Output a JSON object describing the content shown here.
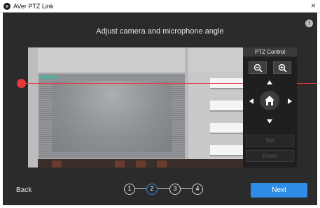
{
  "window": {
    "title": "AVer PTZ Link",
    "close_glyph": "×"
  },
  "main": {
    "heading": "Adjust camera and microphone angle",
    "help_glyph": "!"
  },
  "ptz": {
    "header": "PTZ Control",
    "set_label": "Set",
    "reset_label": "Reset",
    "icons": [
      "zoom-out-icon",
      "zoom-in-icon",
      "arrow-up-icon",
      "arrow-down-icon",
      "arrow-left-icon",
      "arrow-right-icon",
      "home-icon"
    ]
  },
  "nav": {
    "back_label": "Back",
    "next_label": "Next",
    "steps": [
      "1",
      "2",
      "3",
      "4"
    ],
    "current_step": 2
  },
  "colors": {
    "accent": "#2e8ce6",
    "guide_line": "#e8383a",
    "background": "#2b2b2b"
  }
}
